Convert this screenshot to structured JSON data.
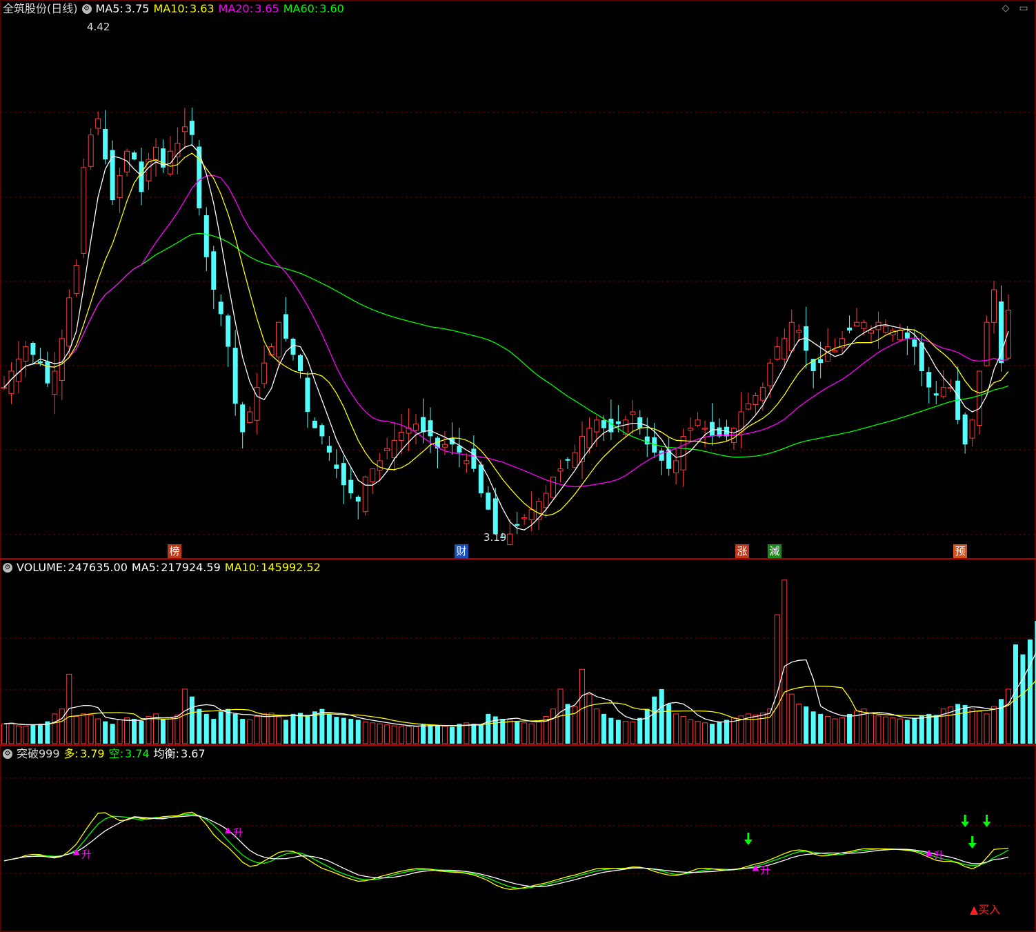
{
  "header_main": {
    "title": "全筑股份(日线)",
    "ma5_label": "MA5:",
    "ma5_value": "3.75",
    "ma10_label": "MA10:",
    "ma10_value": "3.63",
    "ma20_label": "MA20:",
    "ma20_value": "3.65",
    "ma60_label": "MA60:",
    "ma60_value": "3.60"
  },
  "header_volume": {
    "vol_label": "VOLUME:",
    "vol_value": "247635.00",
    "ma5_label": "MA5:",
    "ma5_value": "217924.59",
    "ma10_label": "MA10:",
    "ma10_value": "145992.52"
  },
  "header_indicator": {
    "name": "突破999",
    "duo_label": "多:",
    "duo_value": "3.79",
    "kong_label": "空:",
    "kong_value": "3.74",
    "junheng_label": "均衡:",
    "junheng_value": "3.67"
  },
  "annotations": {
    "high_label": "4.42",
    "low_label": "3.19",
    "rise_label": "升",
    "buy_label": "▲买入"
  },
  "event_badges": [
    {
      "text": "榜",
      "color": "#c0391b"
    },
    {
      "text": "财",
      "color": "#1a4fb8"
    },
    {
      "text": "涨",
      "color": "#c0391b"
    },
    {
      "text": "減",
      "color": "#1e8a1e"
    },
    {
      "text": "预",
      "color": "#d0541b"
    }
  ],
  "icons": {
    "settings": "gear-icon",
    "diamond": "diamond-icon",
    "window": "window-icon"
  },
  "colors": {
    "up": "#ff3b3b",
    "down": "#54fcfc",
    "ma5": "#ffffff",
    "ma10": "#ffff00",
    "ma20": "#ff00ff",
    "ma60": "#00ff00",
    "grid": "#7a0000",
    "border": "#b00000"
  },
  "chart_data": [
    {
      "type": "candlestick",
      "title": "全筑股份(日线)",
      "y_range": [
        3.19,
        4.42
      ],
      "high": 4.42,
      "low": 3.19,
      "series": [
        {
          "name": "MA5",
          "last": 3.75
        },
        {
          "name": "MA10",
          "last": 3.63
        },
        {
          "name": "MA20",
          "last": 3.65
        },
        {
          "name": "MA60",
          "last": 3.6
        }
      ],
      "close": [
        3.56,
        3.6,
        3.63,
        3.66,
        3.64,
        3.62,
        3.57,
        3.6,
        3.68,
        3.78,
        3.86,
        4.1,
        4.18,
        4.22,
        4.12,
        4.02,
        4.08,
        4.14,
        4.12,
        4.04,
        4.12,
        4.15,
        4.1,
        4.14,
        4.16,
        4.2,
        4.18,
        4.0,
        3.88,
        3.8,
        3.74,
        3.66,
        3.52,
        3.45,
        3.5,
        3.56,
        3.62,
        3.66,
        3.72,
        3.68,
        3.64,
        3.6,
        3.5,
        3.46,
        3.44,
        3.4,
        3.36,
        3.32,
        3.3,
        3.28,
        3.34,
        3.36,
        3.38,
        3.41,
        3.43,
        3.45,
        3.46,
        3.47,
        3.45,
        3.44,
        3.41,
        3.42,
        3.42,
        3.4,
        3.38,
        3.36,
        3.3,
        3.26,
        3.2,
        3.19,
        3.2,
        3.22,
        3.24,
        3.26,
        3.28,
        3.3,
        3.34,
        3.36,
        3.38,
        3.4,
        3.44,
        3.46,
        3.48,
        3.46,
        3.45,
        3.47,
        3.48,
        3.5,
        3.46,
        3.42,
        3.4,
        3.38,
        3.36,
        3.38,
        3.44,
        3.46,
        3.48,
        3.46,
        3.44,
        3.44,
        3.44,
        3.46,
        3.5,
        3.52,
        3.54,
        3.56,
        3.62,
        3.66,
        3.68,
        3.72,
        3.7,
        3.65,
        3.6,
        3.62,
        3.66,
        3.65,
        3.68,
        3.7,
        3.72,
        3.72,
        3.7,
        3.72,
        3.71,
        3.7,
        3.7,
        3.68,
        3.66,
        3.6,
        3.56,
        3.54,
        3.56,
        3.56,
        3.48,
        3.42,
        3.48,
        3.6,
        3.72,
        3.8,
        3.62,
        3.75
      ]
    },
    {
      "type": "bar",
      "title": "VOLUME",
      "series": [
        {
          "name": "VOLUME",
          "last": 247635.0
        },
        {
          "name": "MA5",
          "last": 217924.59
        },
        {
          "name": "MA10",
          "last": 145992.52
        }
      ],
      "values": [
        40000,
        42000,
        36000,
        35000,
        38000,
        40000,
        45000,
        60000,
        70000,
        140000,
        55000,
        60000,
        58000,
        50000,
        45000,
        40000,
        48000,
        52000,
        50000,
        46000,
        55000,
        60000,
        50000,
        52000,
        58000,
        110000,
        95000,
        70000,
        60000,
        50000,
        65000,
        70000,
        60000,
        50000,
        48000,
        55000,
        60000,
        62000,
        54000,
        48000,
        60000,
        62000,
        58000,
        65000,
        70000,
        60000,
        54000,
        52000,
        50000,
        48000,
        44000,
        42000,
        40000,
        38000,
        36000,
        35000,
        34000,
        34000,
        40000,
        38000,
        36000,
        35000,
        34000,
        40000,
        42000,
        40000,
        38000,
        60000,
        55000,
        50000,
        48000,
        44000,
        42000,
        40000,
        45000,
        55000,
        70000,
        110000,
        80000,
        75000,
        150000,
        100000,
        70000,
        60000,
        52000,
        48000,
        45000,
        44000,
        52000,
        70000,
        95000,
        110000,
        80000,
        60000,
        55000,
        48000,
        45000,
        42000,
        40000,
        44000,
        48000,
        52000,
        56000,
        60000,
        58000,
        62000,
        70000,
        260000,
        330000,
        100000,
        80000,
        75000,
        65000,
        60000,
        55000,
        50000,
        52000,
        60000,
        66000,
        70000,
        62000,
        56000,
        54000,
        52000,
        50000,
        48000,
        52000,
        56000,
        60000,
        58000,
        70000,
        74000,
        80000,
        78000,
        70000,
        65000,
        60000,
        75000,
        90000,
        110000,
        200000,
        180000,
        210000,
        247635
      ]
    },
    {
      "type": "line",
      "title": "突破999",
      "series": [
        {
          "name": "多",
          "last": 3.79
        },
        {
          "name": "空",
          "last": 3.74
        },
        {
          "name": "均衡",
          "last": 3.67
        }
      ]
    }
  ]
}
